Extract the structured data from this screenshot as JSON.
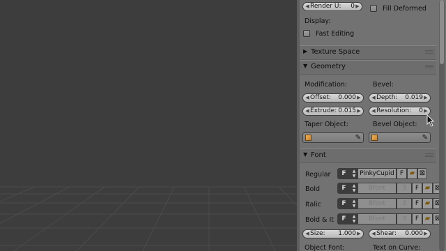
{
  "render_u": {
    "label": "Render U:",
    "value": "0"
  },
  "fill_deformed": {
    "label": "Fill Deformed",
    "checked": false
  },
  "display": {
    "label": "Display:",
    "fast_editing": {
      "label": "Fast Editing",
      "checked": false
    }
  },
  "sections": {
    "texture_space": {
      "title": "Texture Space",
      "expanded": false
    },
    "geometry": {
      "title": "Geometry",
      "expanded": true
    },
    "font": {
      "title": "Font",
      "expanded": true
    }
  },
  "geometry": {
    "modification_label": "Modification:",
    "bevel_label": "Bevel:",
    "offset": {
      "label": "Offset:",
      "value": "0.000"
    },
    "depth": {
      "label": "Depth:",
      "value": "0.019"
    },
    "extrude": {
      "label": "Extrude:",
      "value": "0.015"
    },
    "resolution": {
      "label": "Resolution:",
      "value": "0"
    },
    "taper_object_label": "Taper Object:",
    "bevel_object_label": "Bevel Object:"
  },
  "font": {
    "rows": [
      {
        "label": "Regular",
        "font_icon": "F",
        "name": "PinkyCupid",
        "users": "",
        "fake_user": "F",
        "active": true
      },
      {
        "label": "Bold",
        "font_icon": "F",
        "name": "Bfont",
        "users": "3",
        "fake_user": "F",
        "active": false
      },
      {
        "label": "Italic",
        "font_icon": "F",
        "name": "Bfont",
        "users": "3",
        "fake_user": "F",
        "active": false
      },
      {
        "label": "Bold & It",
        "font_icon": "F",
        "name": "Bfont",
        "users": "3",
        "fake_user": "F",
        "active": false
      }
    ],
    "size": {
      "label": "Size:",
      "value": "1.000"
    },
    "shear": {
      "label": "Shear:",
      "value": "0.000"
    },
    "object_font_label": "Object Font:",
    "text_on_curve_label": "Text on Curve:"
  },
  "colors": {
    "viewport_bg": "#3d3d3d",
    "panel_bg": "#727272",
    "grid_line": "#4a4a4a"
  }
}
